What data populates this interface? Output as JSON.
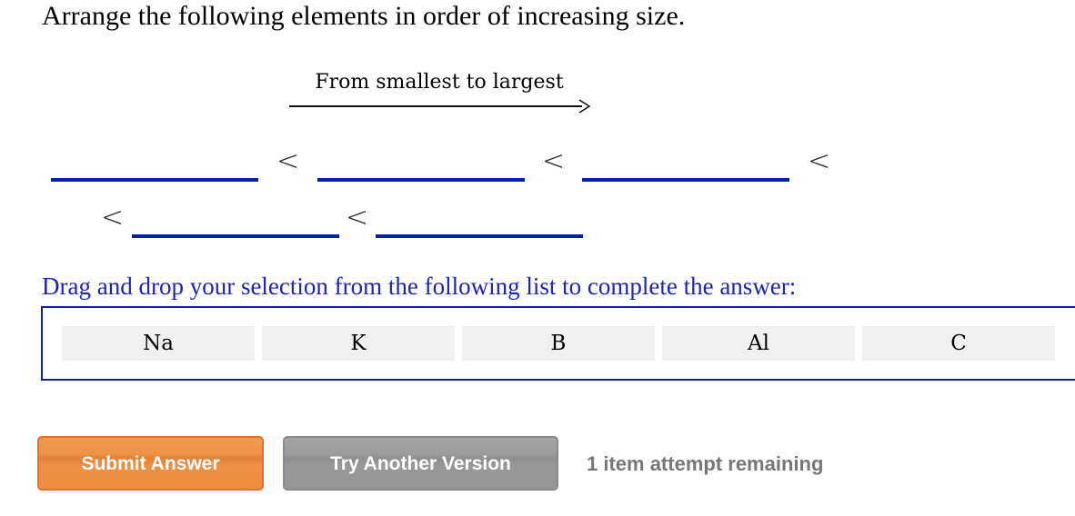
{
  "question": {
    "prompt": "Arrange the following elements in order of increasing size.",
    "direction_label": "From smallest to largest",
    "comparison_symbol": "<",
    "blanks": [
      "",
      "",
      "",
      "",
      ""
    ]
  },
  "drag_drop": {
    "instruction": "Drag and drop your selection from the following list to complete the answer:",
    "items": [
      "Na",
      "K",
      "B",
      "Al",
      "C"
    ]
  },
  "actions": {
    "submit_label": "Submit Answer",
    "try_another_label": "Try Another Version",
    "attempts_text": "1 item attempt remaining"
  },
  "colors": {
    "blank_line": "#0021a5",
    "instruction_text": "#1a25b4",
    "dropbox_border": "#0a1fa5",
    "tile_bg": "#f0f0f0",
    "submit_bg": "#ef8f42",
    "try_bg": "#999999",
    "attempts_text": "#777777"
  }
}
